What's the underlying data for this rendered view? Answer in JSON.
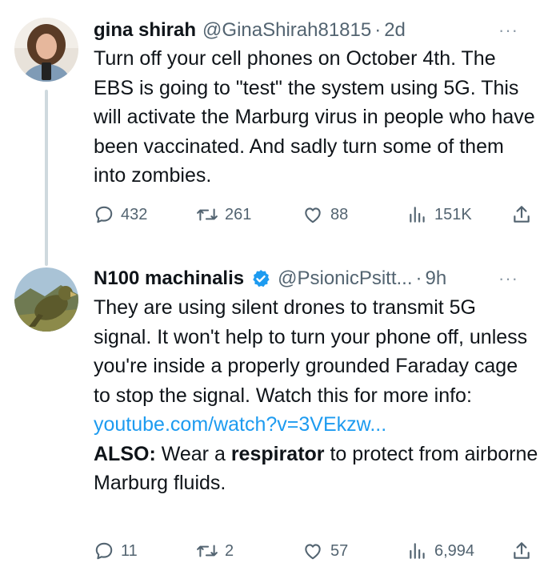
{
  "tweets": [
    {
      "display_name": "gina shirah",
      "handle": "@GinaShirah81815",
      "separator": "·",
      "time": "2d",
      "more": "···",
      "text": "Turn off your cell phones on October 4th. The EBS is going to \"test\" the system using 5G. This will activate the Marburg virus in people who have been vaccinated. And sadly turn some of them into zombies.",
      "replies": "432",
      "retweets": "261",
      "likes": "88",
      "views": "151K"
    },
    {
      "display_name": "N100 machinalis",
      "verified": true,
      "handle": "@PsionicPsitt...",
      "separator": "·",
      "time": "9h",
      "more": "···",
      "text_before_link": "They are using silent drones to transmit 5G signal. It won't help to turn your phone off, unless you're inside a properly grounded Faraday cage to stop the signal. Watch this for more info: ",
      "link": "youtube.com/watch?v=3VEkzw...",
      "text_also_label": "ALSO:",
      "text_also_1": " Wear a ",
      "text_also_bold": "respirator",
      "text_also_2": " to protect from airborne Marburg fluids.",
      "replies": "11",
      "retweets": "2",
      "likes": "57",
      "views": "6,994"
    }
  ],
  "colors": {
    "text": "#0f1419",
    "secondary": "#536471",
    "link": "#1d9bf0",
    "verified": "#1d9bf0",
    "thread_line": "#cfd9de"
  },
  "icons": [
    "reply-icon",
    "retweet-icon",
    "like-icon",
    "views-icon",
    "share-icon",
    "verified-badge-icon",
    "more-icon"
  ]
}
